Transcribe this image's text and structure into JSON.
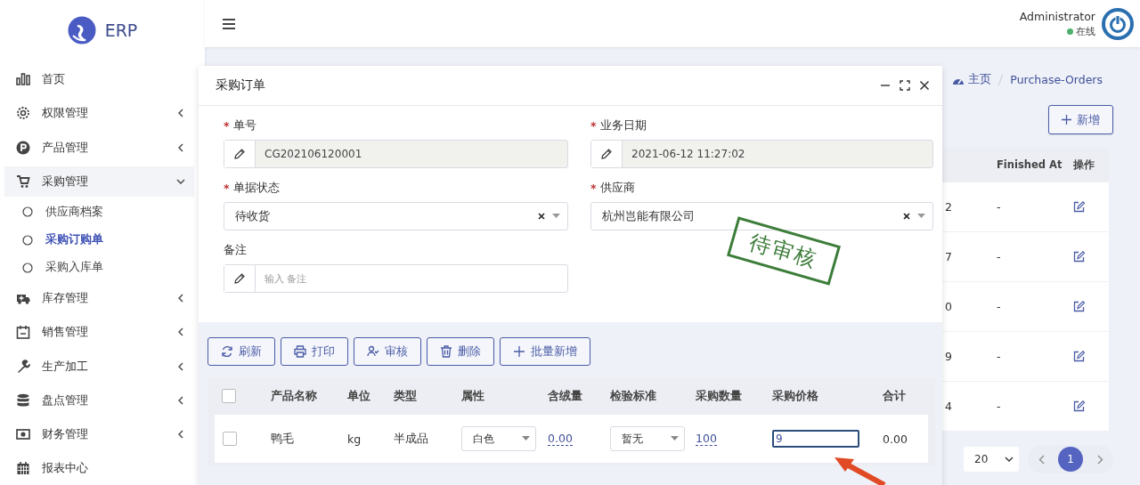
{
  "sidebar": {
    "logo": "ERP",
    "items": [
      {
        "label": "首页"
      },
      {
        "label": "权限管理",
        "expanded": false
      },
      {
        "label": "产品管理",
        "expanded": false
      },
      {
        "label": "采购管理",
        "expanded": true,
        "children": [
          {
            "label": "供应商档案",
            "selected": false
          },
          {
            "label": "采购订购单",
            "selected": true
          },
          {
            "label": "采购入库单",
            "selected": false
          }
        ]
      },
      {
        "label": "库存管理",
        "expanded": false
      },
      {
        "label": "销售管理",
        "expanded": false
      },
      {
        "label": "生产加工",
        "expanded": false
      },
      {
        "label": "盘点管理",
        "expanded": false
      },
      {
        "label": "财务管理",
        "expanded": false
      },
      {
        "label": "报表中心"
      }
    ]
  },
  "header": {
    "user": "Administrator",
    "status": "在线",
    "online": true
  },
  "breadcrumb": [
    {
      "label": "主页"
    },
    {
      "label": "Purchase-Orders"
    }
  ],
  "add_button": "新增",
  "orders_table": {
    "columns": [
      {
        "label": "Finished At"
      },
      {
        "label": "操作"
      }
    ],
    "rows": [
      {
        "column_1": "2",
        "finished_at": "-"
      },
      {
        "column_1": "7",
        "finished_at": "-"
      },
      {
        "column_1": "0",
        "finished_at": "-"
      },
      {
        "column_1": "9",
        "finished_at": "-"
      },
      {
        "column_1": "4",
        "finished_at": "-"
      }
    ]
  },
  "pagination": {
    "page_size": "20",
    "pages": [
      {
        "label": "1",
        "selected": true
      }
    ]
  },
  "modal": {
    "title": "采购订单",
    "fields": [
      {
        "kind": "readonly",
        "label": "单号",
        "required_mark": "*",
        "value": "CG202106120001"
      },
      {
        "kind": "readonly",
        "label": "业务日期",
        "required_mark": "*",
        "value": "2021-06-12 11:27:02"
      },
      {
        "kind": "select",
        "label": "单据状态",
        "required_mark": "*",
        "value": "待收货"
      },
      {
        "kind": "select",
        "label": "供应商",
        "required_mark": "*",
        "value": "杭州岂能有限公司"
      },
      {
        "kind": "text",
        "label": "备注",
        "placeholder": "输入 备注"
      }
    ],
    "stamp": "待审核",
    "toolbar": [
      "刷新",
      "打印",
      "审核",
      "删除",
      "批量新增"
    ],
    "items_table": {
      "all_checked": false,
      "columns": [
        "产品名称",
        "单位",
        "类型",
        "属性",
        "含绒量",
        "检验标准",
        "采购数量",
        "采购价格",
        "合计"
      ],
      "rows": [
        {
          "checked": false,
          "product": "鸭毛",
          "unit": "kg",
          "type": "半成品",
          "attribute": "白色",
          "down_content": "0.00",
          "standard": "暂无",
          "quantity": "100",
          "price": "9",
          "price_focused": true,
          "total": "0.00"
        }
      ]
    }
  }
}
